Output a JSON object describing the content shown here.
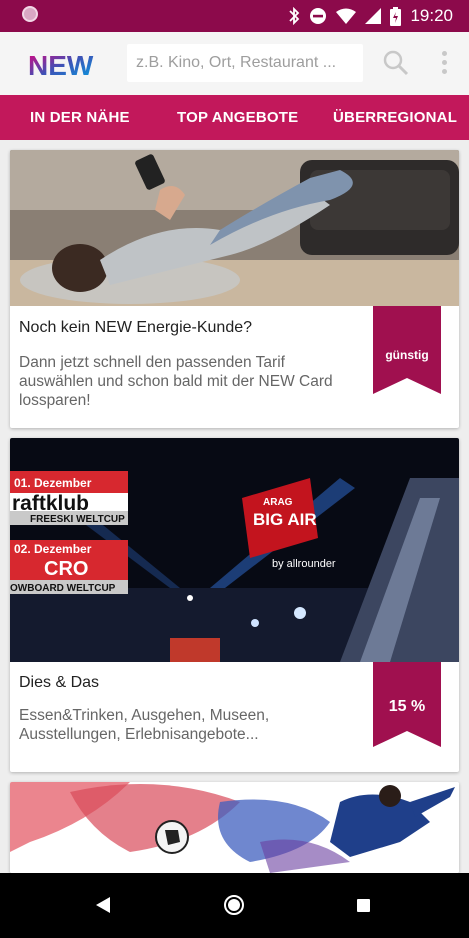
{
  "status": {
    "time": "19:20"
  },
  "appbar": {
    "logo_text": "NEW",
    "search_placeholder": "z.B. Kino, Ort, Restaurant ..."
  },
  "tabs": [
    {
      "label": "IN DER NÄHE"
    },
    {
      "label": "TOP ANGEBOTE"
    },
    {
      "label": "ÜBERREGIONAL"
    }
  ],
  "cards": [
    {
      "title": "Noch kein NEW Energie-Kunde?",
      "description": "Dann jetzt schnell den passenden Tarif auswählen und schon bald mit der NEW Card lossparen!",
      "badge": "günstig"
    },
    {
      "title": "Dies & Das",
      "description": "Essen&Trinken, Ausgehen, Museen, Ausstellungen, Erlebnisangebote...",
      "badge": "15 %",
      "image_text": {
        "date1": "01. Dezember",
        "act1": "raftklub",
        "sub1": "FREESKI WELTCUP",
        "date2": "02. Dezember",
        "act2": "CRO",
        "sub2": "OWBOARD WELTCUP",
        "event_brand": "ARAG",
        "event_name": "BIG AIR",
        "event_sub": "by allrounder"
      }
    },
    {
      "title": "",
      "description": ""
    }
  ],
  "colors": {
    "status_bar": "#8c0a4b",
    "tab_bar": "#c2185b",
    "ribbon": "#a0104f"
  }
}
